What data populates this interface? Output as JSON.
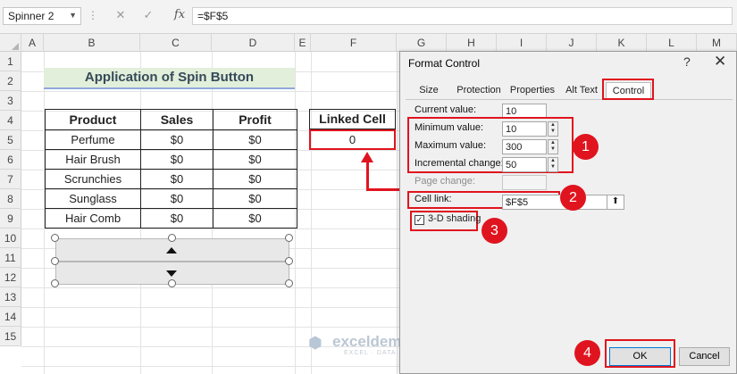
{
  "formula_bar": {
    "name_box": "Spinner 2",
    "cancel_icon": "✕",
    "enter_icon": "✓",
    "fx_label": "fx",
    "formula": "=$F$5"
  },
  "columns": [
    "A",
    "B",
    "C",
    "D",
    "E",
    "F",
    "G",
    "H",
    "I",
    "J",
    "K",
    "L",
    "M"
  ],
  "rows": [
    "1",
    "2",
    "3",
    "4",
    "5",
    "6",
    "7",
    "8",
    "9",
    "10",
    "11",
    "12",
    "13",
    "14",
    "15"
  ],
  "sheet": {
    "title": "Application of Spin Button",
    "table_headers": [
      "Product",
      "Sales",
      "Profit"
    ],
    "table_rows": [
      [
        "Perfume",
        "$0",
        "$0"
      ],
      [
        "Hair Brush",
        "$0",
        "$0"
      ],
      [
        "Scrunchies",
        "$0",
        "$0"
      ],
      [
        "Sunglass",
        "$0",
        "$0"
      ],
      [
        "Hair Comb",
        "$0",
        "$0"
      ]
    ],
    "linked_cell_header": "Linked Cell",
    "linked_cell_value": "0"
  },
  "dialog": {
    "title": "Format Control",
    "help": "?",
    "close": "✕",
    "tabs": [
      "Size",
      "Protection",
      "Properties",
      "Alt Text",
      "Control"
    ],
    "active_tab": "Control",
    "current_value_label": "Current value:",
    "current_value": "10",
    "minimum_value_label": "Minimum value:",
    "minimum_value": "10",
    "maximum_value_label": "Maximum value:",
    "maximum_value": "300",
    "incremental_change_label": "Incremental change:",
    "incremental_change": "50",
    "page_change_label": "Page change:",
    "page_change": "",
    "cell_link_label": "Cell link:",
    "cell_link": "$F$5",
    "shading_label": "3-D shading",
    "shading_checked": true,
    "ok_label": "OK",
    "cancel_label": "Cancel"
  },
  "annotations": [
    "1",
    "2",
    "3",
    "4"
  ],
  "watermark": {
    "name": "exceldemy",
    "tagline": "EXCEL · DATA · BI"
  },
  "colors": {
    "highlight_red": "#e0141e",
    "title_fill": "#e2efda",
    "title_underline": "#8ea9db"
  }
}
